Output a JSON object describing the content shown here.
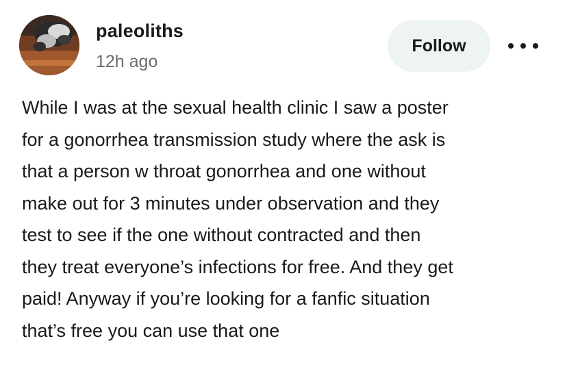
{
  "post": {
    "author": {
      "username": "paleoliths",
      "timestamp": "12h ago",
      "avatar": "cat-photo-avatar"
    },
    "actions": {
      "follow_label": "Follow",
      "more_icon": "more-options-icon"
    },
    "body": "While I was at the sexual health clinic I saw a poster\nfor a gonorrhea transmission study where the ask is\nthat a person w throat gonorrhea and one without\nmake out for 3 minutes under observation and they\ntest to see if the one without contracted and then\nthey treat everyone’s infections for free. And they get\npaid! Anyway if you’re looking for a fanfic situation\nthat’s free you can use that one"
  },
  "colors": {
    "text": "#1a1a1a",
    "muted": "#6b6b6b",
    "follow_bg": "#eef3f3",
    "background": "#ffffff"
  }
}
